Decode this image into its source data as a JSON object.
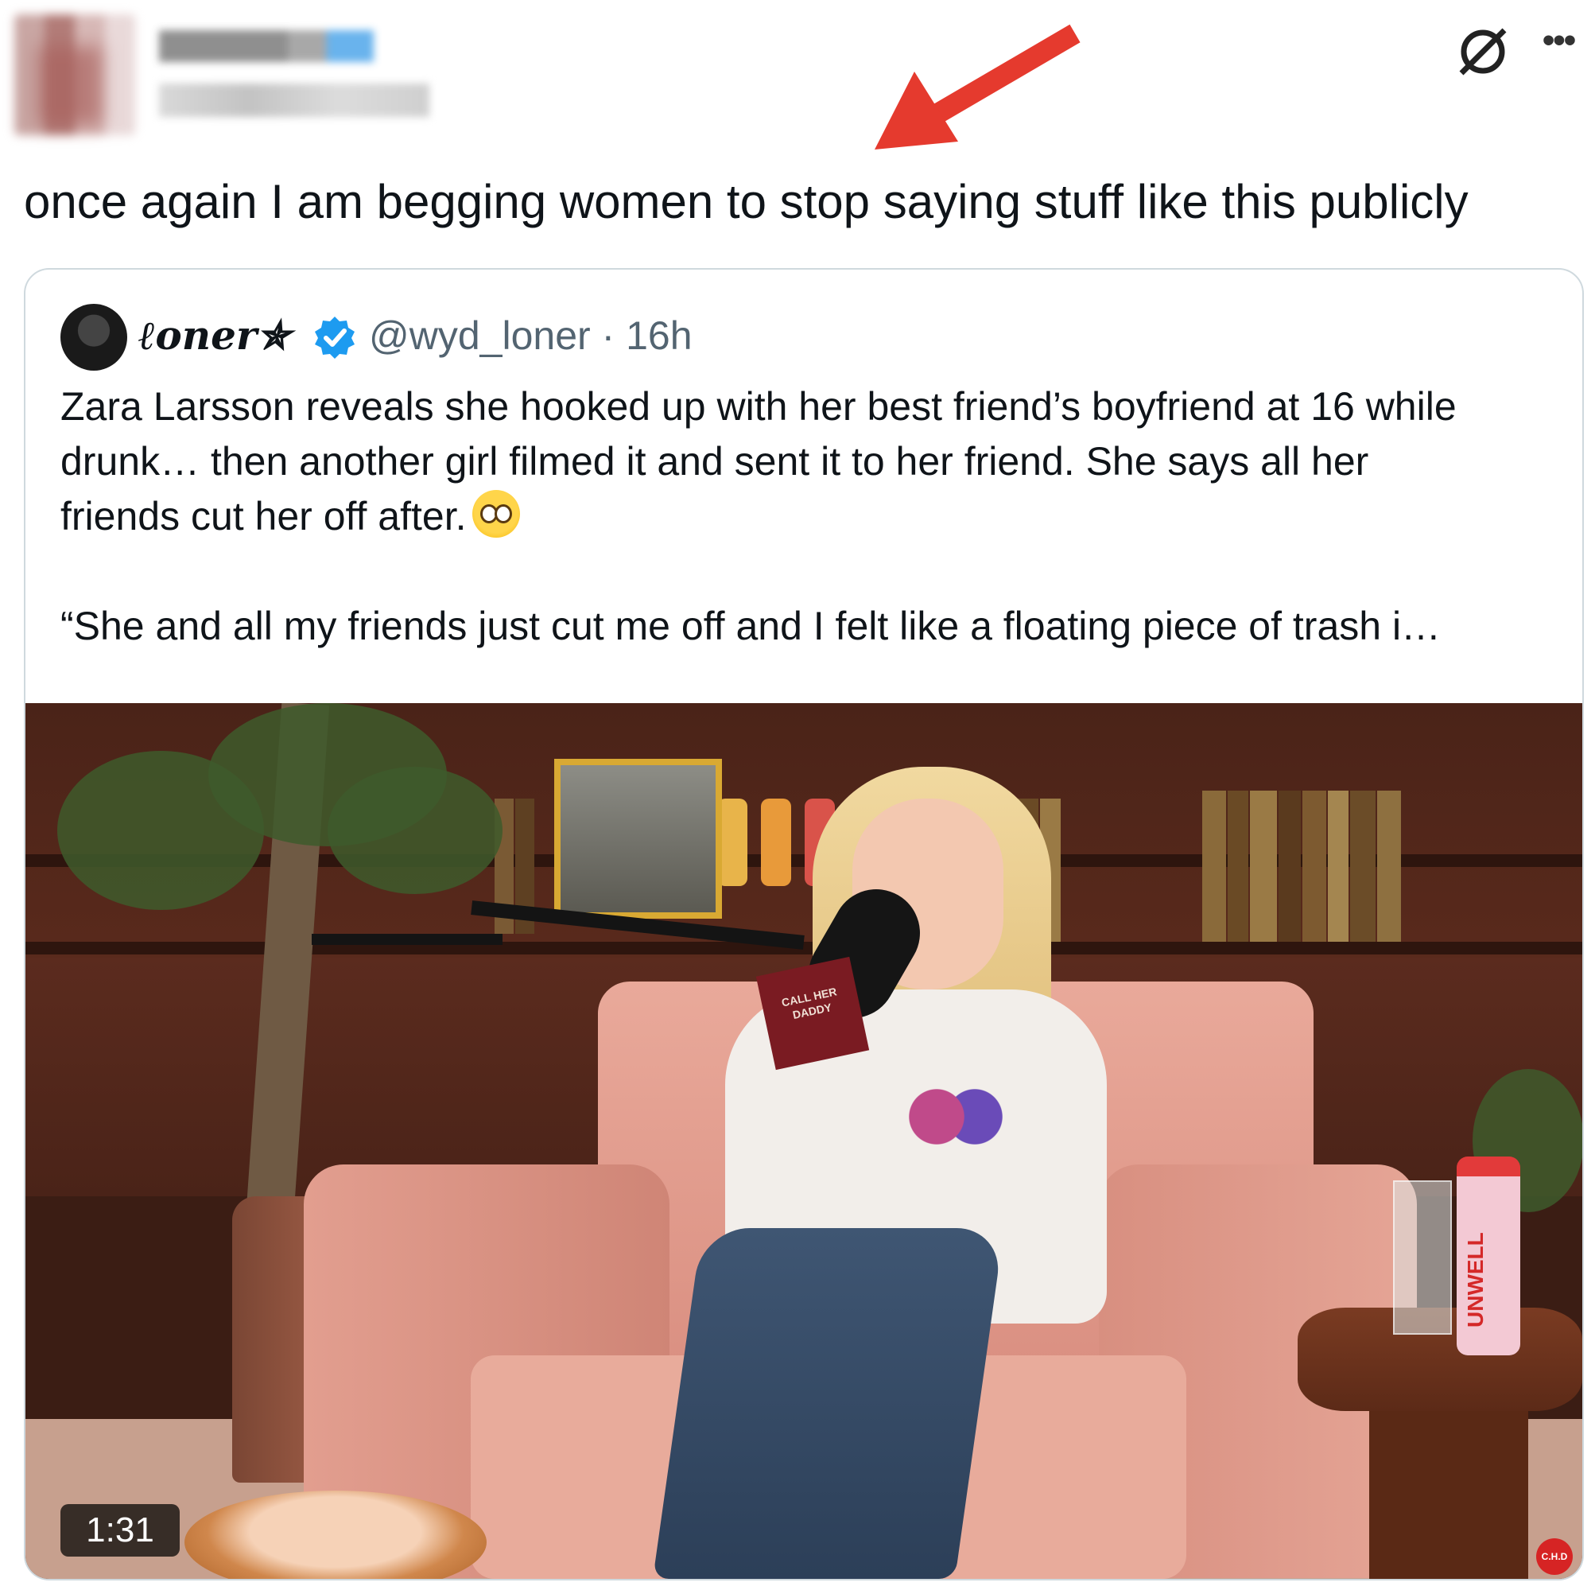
{
  "post": {
    "text": "once again I am begging women to stop saying stuff like this publicly"
  },
  "quote": {
    "display_name": "ℓoner✯",
    "meta": "@wyd_loner · 16h",
    "paragraph1_line1": "Zara Larsson reveals she hooked up with her best friend’s boyfriend at 16 while",
    "paragraph1_line2": "drunk… then another girl filmed it and sent it to her friend. She says all her",
    "paragraph1_line3": "friends cut her off after.",
    "paragraph2": "“She and all my friends just cut me off and I felt like a floating piece of trash i…"
  },
  "video": {
    "duration": "1:31",
    "mic_flag_text": "CALL HER DADDY",
    "bottle_label": "UNWELL",
    "corner_badge": "C.H.D"
  },
  "icons": {
    "grok": "grok-icon",
    "more": "more-icon",
    "verified": "verified-badge-icon",
    "arrow": "red-arrow-annotation",
    "emoji": "flushed-face-emoji"
  },
  "colors": {
    "arrow": "#e53a2e",
    "verified": "#1d9bf0",
    "meta_text": "#536471",
    "card_border": "#cfd9de"
  }
}
